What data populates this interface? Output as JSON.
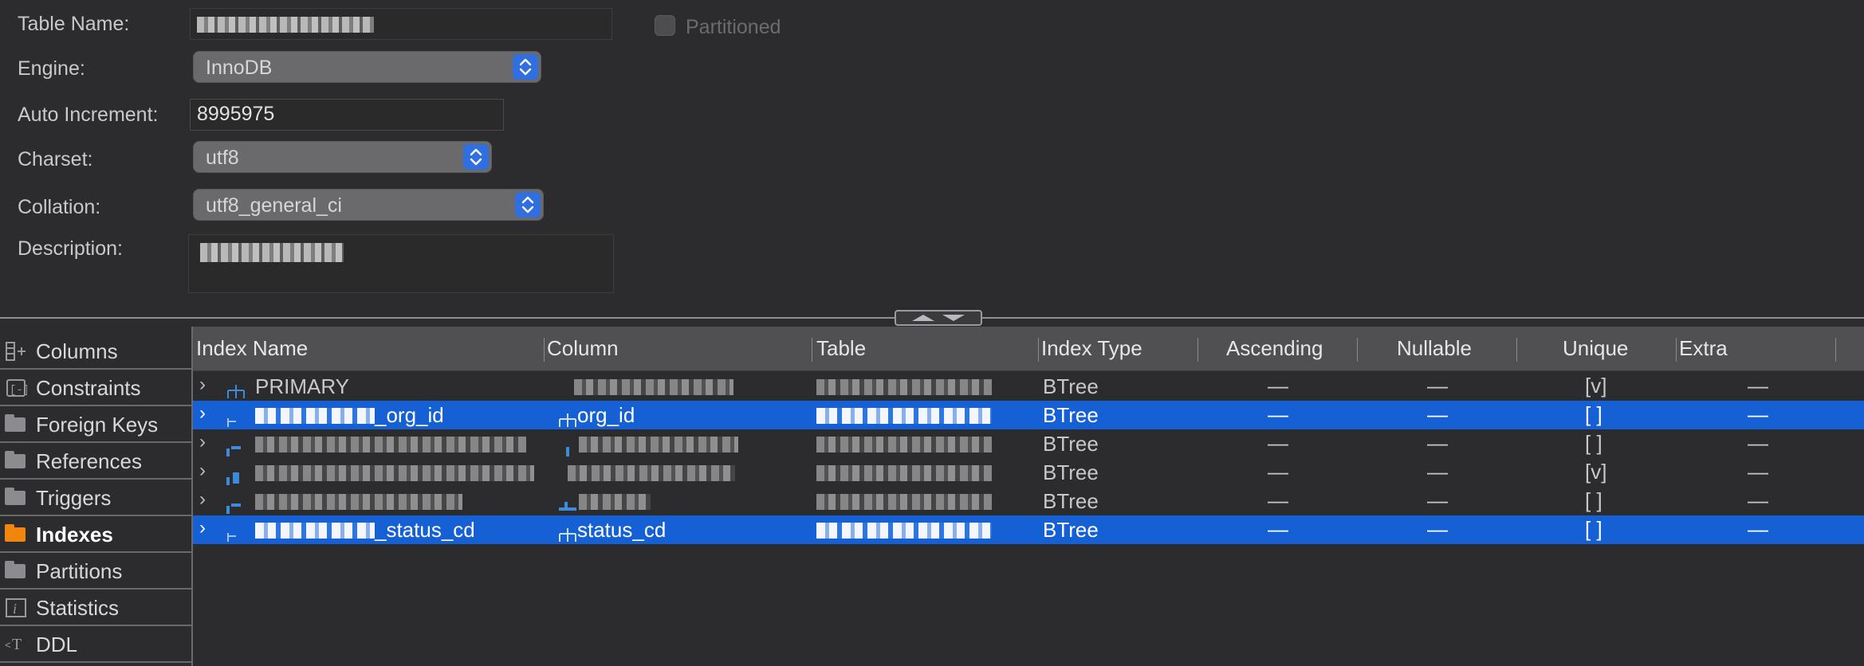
{
  "form": {
    "table_name_label": "Table Name:",
    "engine_label": "Engine:",
    "engine_value": "InnoDB",
    "auto_increment_label": "Auto Increment:",
    "auto_increment_value": "8995975",
    "charset_label": "Charset:",
    "charset_value": "utf8",
    "collation_label": "Collation:",
    "collation_value": "utf8_general_ci",
    "description_label": "Description:",
    "partitioned_label": "Partitioned",
    "partitioned_checked": false
  },
  "nav": {
    "items": [
      {
        "label": "Columns",
        "icon": "columns-icon"
      },
      {
        "label": "Constraints",
        "icon": "constraints-icon"
      },
      {
        "label": "Foreign Keys",
        "icon": "folder-icon"
      },
      {
        "label": "References",
        "icon": "folder-icon"
      },
      {
        "label": "Triggers",
        "icon": "folder-icon"
      },
      {
        "label": "Indexes",
        "icon": "folder-icon",
        "active": true
      },
      {
        "label": "Partitions",
        "icon": "folder-icon"
      },
      {
        "label": "Statistics",
        "icon": "info-icon"
      },
      {
        "label": "DDL",
        "icon": "ddl-icon"
      }
    ]
  },
  "grid": {
    "columns": [
      "Index Name",
      "Column",
      "Table",
      "Index Type",
      "Ascending",
      "Nullable",
      "Unique",
      "Extra"
    ],
    "rows": [
      {
        "index_name": "PRIMARY",
        "column": "",
        "index_type": "BTree",
        "ascending": "—",
        "nullable": "—",
        "unique": "[v]",
        "extra": "—",
        "selected": false
      },
      {
        "index_name": "_org_id",
        "column": "org_id",
        "index_type": "BTree",
        "ascending": "—",
        "nullable": "—",
        "unique": "[ ]",
        "extra": "—",
        "selected": true
      },
      {
        "index_name": "",
        "column": "",
        "index_type": "BTree",
        "ascending": "—",
        "nullable": "—",
        "unique": "[ ]",
        "extra": "—",
        "selected": false
      },
      {
        "index_name": "",
        "column": "",
        "index_type": "BTree",
        "ascending": "—",
        "nullable": "—",
        "unique": "[v]",
        "extra": "—",
        "selected": false
      },
      {
        "index_name": "",
        "column": "",
        "index_type": "BTree",
        "ascending": "—",
        "nullable": "—",
        "unique": "[ ]",
        "extra": "—",
        "selected": false
      },
      {
        "index_name": "_status_cd",
        "column": "status_cd",
        "index_type": "BTree",
        "ascending": "—",
        "nullable": "—",
        "unique": "[ ]",
        "extra": "—",
        "selected": true
      }
    ]
  },
  "colors": {
    "background": "#2c2c2e",
    "selection": "#1560d4",
    "accent_orange": "#f0860e",
    "stepper_blue": "#2f6fe0"
  }
}
